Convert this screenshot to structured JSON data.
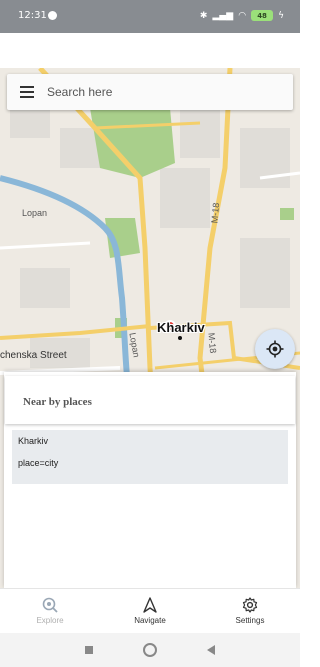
{
  "status_bar": {
    "time": "12:31",
    "battery": "48"
  },
  "search": {
    "placeholder": "Search here"
  },
  "map": {
    "city_label": "Kharkiv",
    "streets": {
      "lopan_1": "Lopan",
      "lopan_2": "Lopan",
      "m18_1": "M-18",
      "m18_2": "M-18",
      "street_partial": "chenska Street"
    }
  },
  "sheet": {
    "title": "Near by places",
    "places": [
      {
        "name": "Kharkiv",
        "type": "place=city"
      }
    ]
  },
  "bottom_nav": [
    {
      "label": "Explore",
      "icon": "explore-search-icon",
      "active": true
    },
    {
      "label": "Navigate",
      "icon": "navigation-arrow-icon",
      "active": false
    },
    {
      "label": "Settings",
      "icon": "gear-icon",
      "active": false
    }
  ],
  "colors": {
    "map_background": "#eeeae3",
    "road_major": "#f4cf6a",
    "river": "#8ab7d8",
    "park": "#a9cf8b",
    "locate_button": "#dbe7f6",
    "status_bar": "#888c91"
  }
}
